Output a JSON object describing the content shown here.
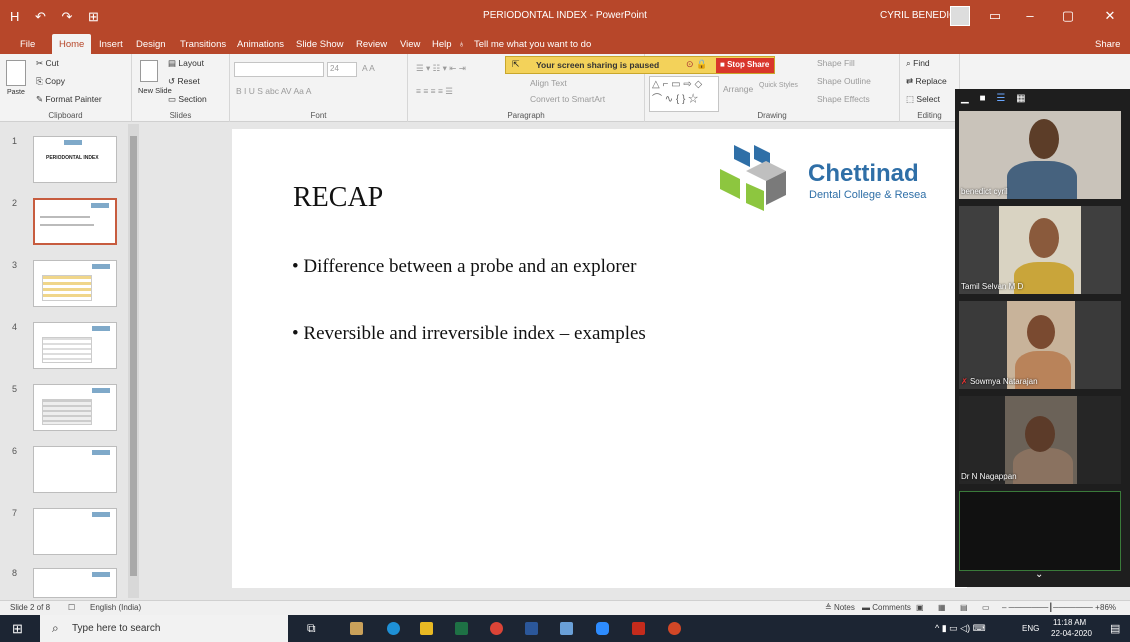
{
  "titlebar": {
    "quick_access": "H ↶ ↷ ⊞",
    "document_title": "PERIODONTAL INDEX - PowerPoint",
    "user_name": "CYRIL BENEDICT",
    "minimize": "–",
    "maximize": "▢",
    "close": "✕"
  },
  "tabs": {
    "file": "File",
    "home": "Home",
    "insert": "Insert",
    "design": "Design",
    "transitions": "Transitions",
    "animations": "Animations",
    "slideshow": "Slide Show",
    "review": "Review",
    "view": "View",
    "help": "Help",
    "tell_me": "Tell me what you want to do",
    "share": "Share"
  },
  "ribbon": {
    "paste": "Paste",
    "cut": "Cut",
    "copy": "Copy",
    "format_painter": "Format Painter",
    "clipboard": "Clipboard",
    "new_slide": "New Slide",
    "layout": "Layout",
    "reset": "Reset",
    "section": "Section",
    "slides": "Slides",
    "font_size": "24",
    "font_buttons": "B  I  U  S  abc  AV  Aa  A",
    "font": "Font",
    "align_text": "Align Text",
    "convert_smartart": "Convert to SmartArt",
    "paragraph": "Paragraph",
    "arrange": "Arrange",
    "quick_styles": "Quick Styles",
    "shape_fill": "Shape Fill",
    "shape_outline": "Shape Outline",
    "shape_effects": "Shape Effects",
    "drawing": "Drawing",
    "find": "Find",
    "replace": "Replace",
    "select": "Select",
    "editing": "Editing"
  },
  "share_banner": {
    "message": "Your screen sharing is paused",
    "stop_label": "Stop Share"
  },
  "thumbnails": [
    {
      "num": "1",
      "title": "PERIODONTAL INDEX"
    },
    {
      "num": "2",
      "title": ""
    },
    {
      "num": "3",
      "title": ""
    },
    {
      "num": "4",
      "title": ""
    },
    {
      "num": "5",
      "title": ""
    },
    {
      "num": "6",
      "title": ""
    },
    {
      "num": "7",
      "title": ""
    },
    {
      "num": "8",
      "title": ""
    }
  ],
  "slide": {
    "title": "RECAP",
    "bullets": [
      "• Difference between a probe and an explorer",
      "• Reversible and irreversible index – examples"
    ],
    "brand_name": "Chettinad",
    "brand_sub": "Dental College & Resea"
  },
  "participants": [
    {
      "name": "benedict cyril"
    },
    {
      "name": "Tamil Selvan M D"
    },
    {
      "name": "Sowmya Natarajan"
    },
    {
      "name": "Dr N Nagappan"
    }
  ],
  "statusbar": {
    "slide_info": "Slide 2 of 8",
    "language": "English (India)",
    "notes": "Notes",
    "comments": "Comments",
    "zoom": "86%"
  },
  "taskbar": {
    "search_placeholder": "Type here to search",
    "language": "ENG",
    "time": "11:18 AM",
    "date": "22-04-2020"
  },
  "colors": {
    "accent": "#b7472a",
    "share_banner": "#f3d25a",
    "stop_share": "#d9362b",
    "brand": "#2f6fa7"
  }
}
